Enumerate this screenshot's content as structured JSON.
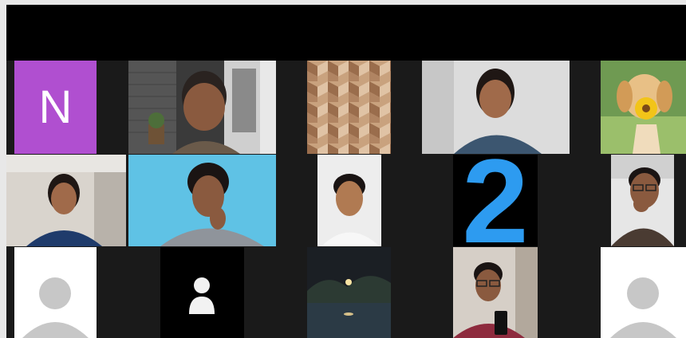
{
  "meeting": {
    "gallery": [
      {
        "id": "n-avatar",
        "type": "initial",
        "text": "N",
        "bg": "#b04fd0"
      },
      {
        "id": "man-bookshelf",
        "type": "video",
        "desc": "camera"
      },
      {
        "id": "wood-pattern",
        "type": "image"
      },
      {
        "id": "woman-smiling",
        "type": "video"
      },
      {
        "id": "dog-sunflower",
        "type": "image"
      },
      {
        "id": "woman-headset",
        "type": "video"
      },
      {
        "id": "man-blue-wall",
        "type": "video"
      },
      {
        "id": "man-white-bg",
        "type": "video"
      },
      {
        "id": "number-two",
        "type": "text",
        "text": "2",
        "color": "#2d9bf0"
      },
      {
        "id": "man-glasses",
        "type": "video"
      },
      {
        "id": "placeholder-1",
        "type": "default-avatar"
      },
      {
        "id": "camera-off",
        "type": "camera-off"
      },
      {
        "id": "moon-lake",
        "type": "image"
      },
      {
        "id": "boy-phone",
        "type": "video"
      },
      {
        "id": "placeholder-2",
        "type": "default-avatar"
      }
    ]
  }
}
